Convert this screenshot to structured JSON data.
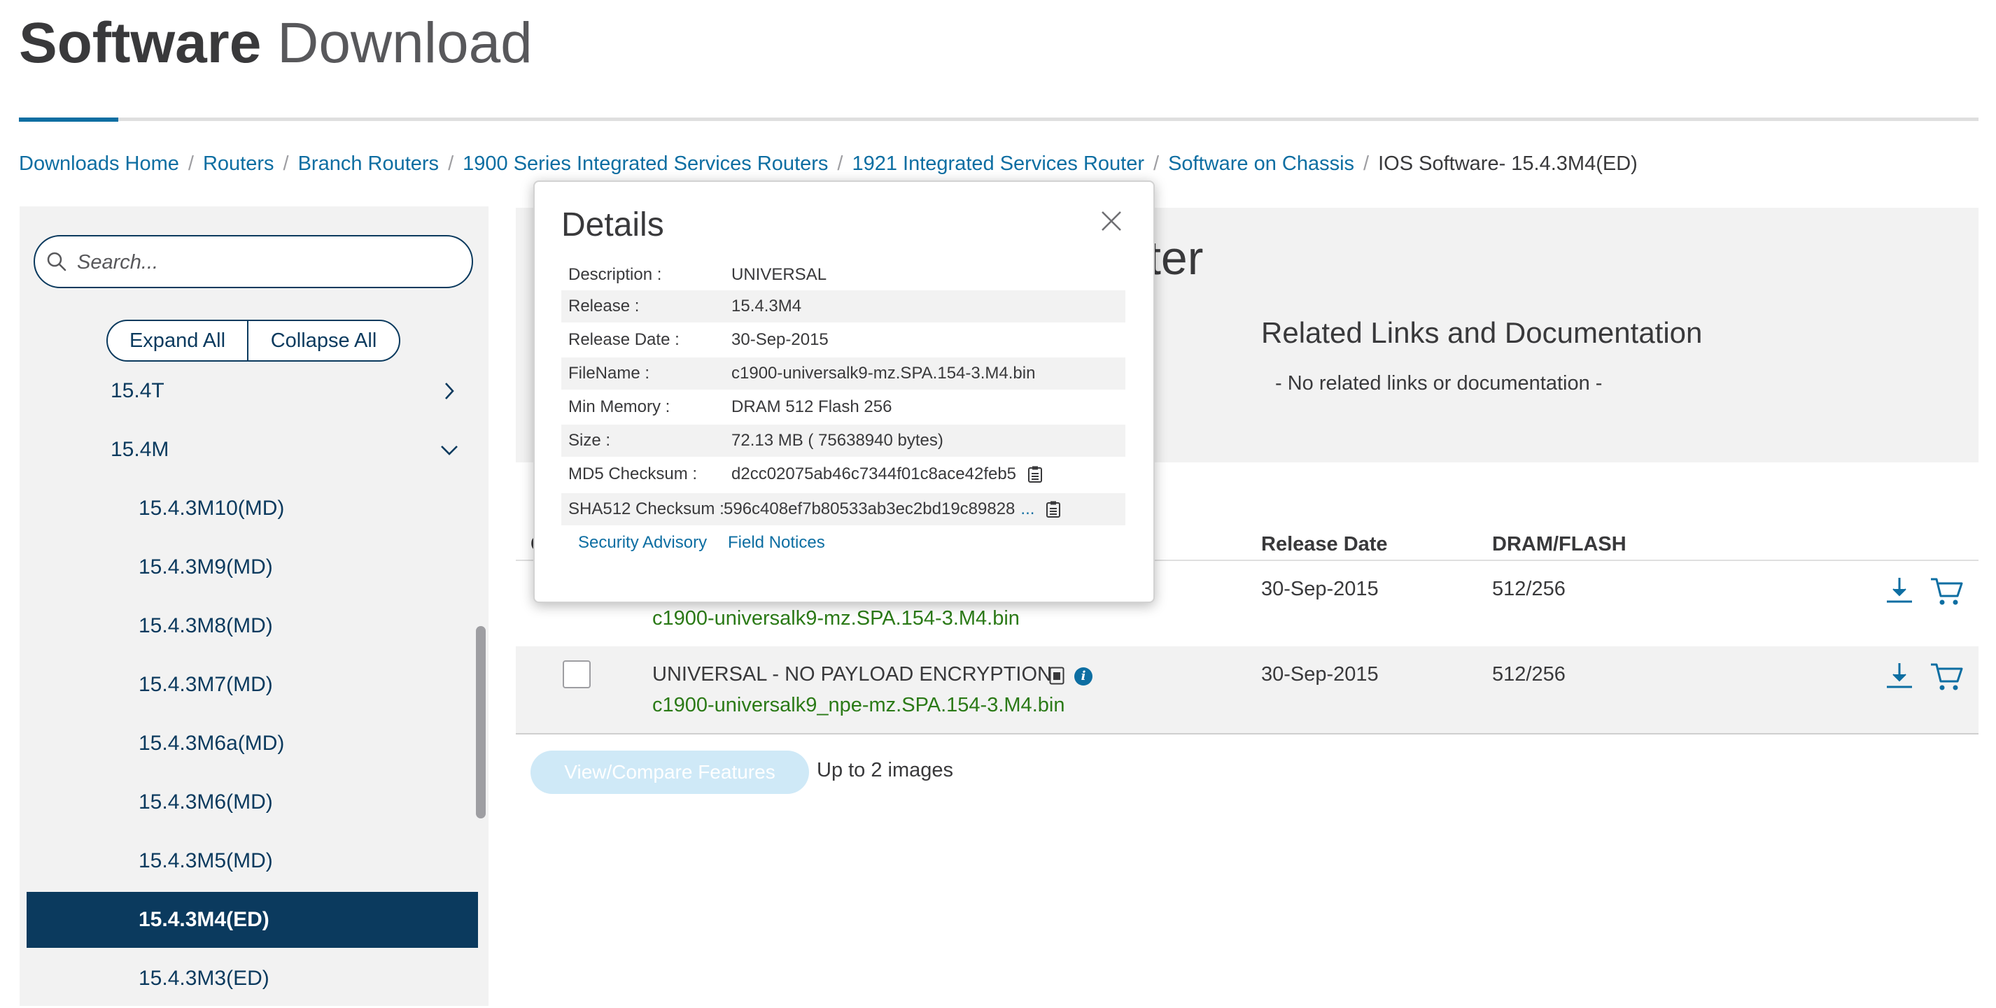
{
  "page": {
    "title_bold": "Software",
    "title_light": "Download"
  },
  "breadcrumb": [
    "Downloads Home",
    "Routers",
    "Branch Routers",
    "1900 Series Integrated Services Routers",
    "1921 Integrated Services Router",
    "Software on Chassis"
  ],
  "breadcrumb_current": "IOS Software- 15.4.3M4(ED)",
  "breadcrumb_separator": "/",
  "sidebar": {
    "search_placeholder": "Search...",
    "expand_all": "Expand All",
    "collapse_all": "Collapse All",
    "groups": [
      {
        "label": "15.4T",
        "chevron": "chevron-right-icon"
      },
      {
        "label": "15.4M",
        "chevron": "chevron-down-icon"
      }
    ],
    "releases": [
      "15.4.3M10(MD)",
      "15.4.3M9(MD)",
      "15.4.3M8(MD)",
      "15.4.3M7(MD)",
      "15.4.3M6a(MD)",
      "15.4.3M6(MD)",
      "15.4.3M5(MD)",
      "15.4.3M4(ED)",
      "15.4.3M3(ED)"
    ],
    "selected_release": "15.4.3M4(ED)"
  },
  "main": {
    "title_fragment": "ter",
    "related_title": "Related Links and Documentation",
    "related_empty": "- No related links or documentation -",
    "columns": {
      "release_date": "Release Date",
      "dram_flash": "DRAM/FLASH",
      "first_col": "C"
    },
    "rows": [
      {
        "description": "",
        "filename": "c1900-universalk9-mz.SPA.154-3.M4.bin",
        "release_date": "30-Sep-2015",
        "dram_flash": "512/256"
      },
      {
        "description": "UNIVERSAL - NO PAYLOAD ENCRYPTION",
        "filename": "c1900-universalk9_npe-mz.SPA.154-3.M4.bin",
        "release_date": "30-Sep-2015",
        "dram_flash": "512/256"
      }
    ],
    "compare_button": "View/Compare Features",
    "compare_note": "Up to 2 images"
  },
  "details": {
    "title": "Details",
    "fields": [
      {
        "label": "Description :",
        "value": "UNIVERSAL"
      },
      {
        "label": "Release :",
        "value": "15.4.3M4"
      },
      {
        "label": "Release Date :",
        "value": "30-Sep-2015"
      },
      {
        "label": "FileName :",
        "value": "c1900-universalk9-mz.SPA.154-3.M4.bin"
      },
      {
        "label": "Min Memory :",
        "value": "DRAM 512 Flash 256"
      },
      {
        "label": "Size :",
        "value": "72.13 MB ( 75638940 bytes)"
      },
      {
        "label": "MD5 Checksum :",
        "value": "d2cc02075ab46c7344f01c8ace42feb5"
      },
      {
        "label": "SHA512 Checksum :",
        "value": "596c408ef7b80533ab3ec2bd19c89828",
        "ellipsis": "..."
      }
    ],
    "links": {
      "security_advisory": "Security Advisory",
      "field_notices": "Field Notices"
    }
  },
  "colors": {
    "link": "#0d6ea2",
    "navy": "#0b3a5e",
    "file_green": "#2b7a17",
    "panel_gray": "#f2f2f2"
  }
}
